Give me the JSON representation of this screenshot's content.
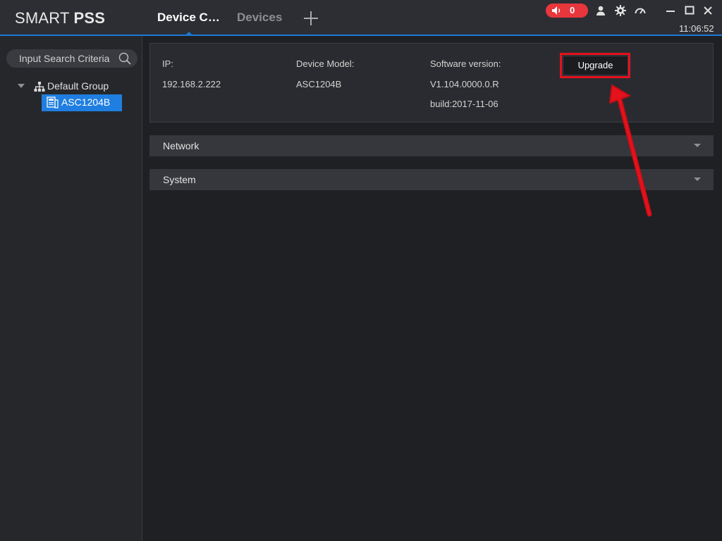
{
  "app": {
    "logo_light": "SMART ",
    "logo_bold": "PSS"
  },
  "tabs": [
    {
      "label": "Device C…",
      "active": true
    },
    {
      "label": "Devices",
      "active": false
    }
  ],
  "header": {
    "alarm_count": "0",
    "time": "11:06:52",
    "icons": [
      "speaker-icon",
      "user-icon",
      "gear-icon",
      "dashboard-icon",
      "minimize-icon",
      "maximize-icon",
      "close-icon"
    ]
  },
  "sidebar": {
    "search_placeholder": "Input Search Criteria",
    "group": {
      "label": "Default Group"
    },
    "device": {
      "label": "ASC1204B"
    }
  },
  "device_info": {
    "ip_label": "IP:",
    "ip_value": "192.168.2.222",
    "model_label": "Device Model:",
    "model_value": "ASC1204B",
    "software_label": "Software version:",
    "software_value": "V1.104.0000.0.R",
    "build_value": "build:2017-11-06",
    "upgrade_label": "Upgrade"
  },
  "sections": [
    {
      "label": "Network"
    },
    {
      "label": "System"
    }
  ],
  "colors": {
    "accent": "#1c7bd6",
    "alarm": "#e8363d",
    "annotation": "#e4121c",
    "selected": "#1f7ee0"
  }
}
